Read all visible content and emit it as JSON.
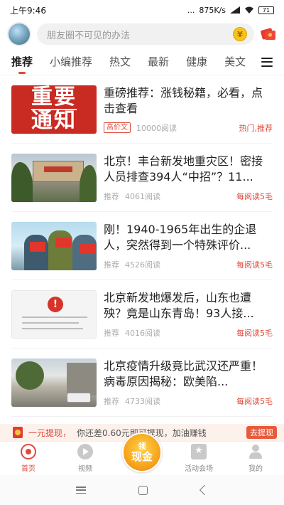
{
  "status": {
    "time": "上午9:46",
    "dots": "...",
    "speed": "875K/s",
    "battery": "71"
  },
  "search": {
    "placeholder": "朋友圈不可见的办法",
    "coin_icon": "coin-icon",
    "coin_symbol": "¥"
  },
  "tabs": [
    {
      "label": "推荐",
      "active": true
    },
    {
      "label": "小编推荐"
    },
    {
      "label": "热文"
    },
    {
      "label": "最新"
    },
    {
      "label": "健康"
    },
    {
      "label": "美文"
    }
  ],
  "articles": [
    {
      "title": "重磅推荐：涨钱秘籍，必看，点击查看",
      "thumb_text": [
        "重要",
        "通知"
      ],
      "tag": "高价文",
      "reads": "10000阅读",
      "right_prefix": "热门,",
      "right_highlight": "推荐"
    },
    {
      "title": "北京！丰台新发地重灾区！密接人员排查394人“中招”？11...",
      "tag": "推荐",
      "reads": "4061阅读",
      "right_prefix": "每阅读",
      "right_highlight": "5毛"
    },
    {
      "title": "刚！1940-1965年出生的企退人，突然得到一个特殊评价...",
      "tag": "推荐",
      "reads": "4526阅读",
      "right_prefix": "每阅读",
      "right_highlight": "5毛"
    },
    {
      "title": "北京新发地爆发后，山东也遭殃？竟是山东青岛！93人接...",
      "thumb_circle": "!",
      "tag": "推荐",
      "reads": "4016阅读",
      "right_prefix": "每阅读",
      "right_highlight": "5毛"
    },
    {
      "title": "北京疫情升级竟比武汉还严重！病毒原因揭秘：欧美陷...",
      "tag": "推荐",
      "reads": "4733阅读",
      "right_prefix": "每阅读",
      "right_highlight": "5毛"
    }
  ],
  "promo": {
    "highlight": "一元提现，",
    "text": "你还差0.60元即可提现，加油赚钱",
    "button": "去提现"
  },
  "tabbar": {
    "items": [
      {
        "label": "首页",
        "icon": "home-icon",
        "active": true
      },
      {
        "label": "视频",
        "icon": "video-icon"
      },
      {
        "label": "",
        "icon": "center"
      },
      {
        "label": "活动会场",
        "icon": "activity-icon"
      },
      {
        "label": "我的",
        "icon": "profile-icon"
      }
    ],
    "center": {
      "line1": "领",
      "line2": "现金"
    }
  },
  "colors": {
    "accent": "#e04a3c",
    "tab_bg": "#fff",
    "promo_bg": "#fdf1ec"
  }
}
